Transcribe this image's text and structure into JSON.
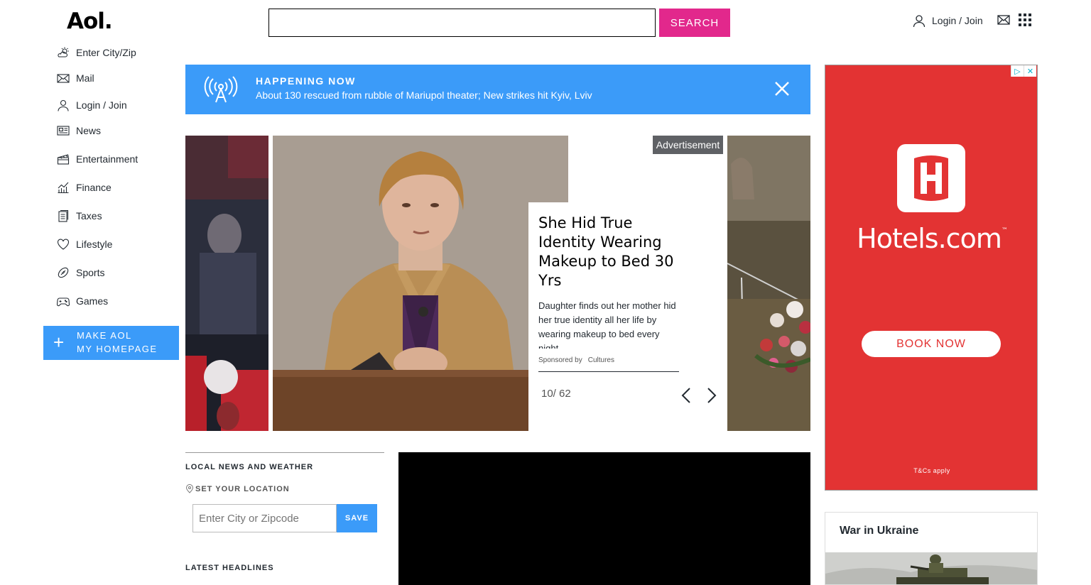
{
  "header": {
    "logo": "Aol.",
    "search_placeholder": "",
    "search_button": "SEARCH",
    "login_label": "Login / Join"
  },
  "sidebar": {
    "items": [
      {
        "label": "Enter City/Zip",
        "icon": "weather-icon"
      },
      {
        "label": "Mail",
        "icon": "mail-icon"
      },
      {
        "label": "Login / Join",
        "icon": "user-icon"
      },
      {
        "label": "News",
        "icon": "news-icon"
      },
      {
        "label": "Entertainment",
        "icon": "clapper-icon"
      },
      {
        "label": "Finance",
        "icon": "chart-icon"
      },
      {
        "label": "Taxes",
        "icon": "document-icon"
      },
      {
        "label": "Lifestyle",
        "icon": "heart-icon"
      },
      {
        "label": "Sports",
        "icon": "football-icon"
      },
      {
        "label": "Games",
        "icon": "gamepad-icon"
      }
    ],
    "make_homepage_line1": "MAKE AOL",
    "make_homepage_line2": "MY HOMEPAGE"
  },
  "happening": {
    "title": "HAPPENING NOW",
    "text": "About 130 rescued from rubble of Mariupol theater; New strikes hit Kyiv, Lviv"
  },
  "carousel": {
    "ad_label": "Advertisement",
    "title": "She Hid True Identity Wearing Makeup to Bed 30 Yrs",
    "description": "Daughter finds out her mother hid her true identity all her life by wearing makeup to bed every night",
    "sponsored_by": "Sponsored by",
    "sponsor": "Cultures",
    "counter": "10/ 62"
  },
  "ad": {
    "brand": "Hotels.com",
    "trademark": "™",
    "cta": "BOOK NOW",
    "terms": "T&Cs apply",
    "brand_color": "#e33333"
  },
  "local": {
    "title": "LOCAL NEWS AND WEATHER",
    "set_location": "SET YOUR LOCATION",
    "zip_placeholder": "Enter City or Zipcode",
    "save_button": "SAVE",
    "latest": "LATEST HEADLINES"
  },
  "ukraine": {
    "title": "War in Ukraine"
  },
  "colors": {
    "accent_blue": "#3b9bf9",
    "search_pink": "#e2288c"
  }
}
